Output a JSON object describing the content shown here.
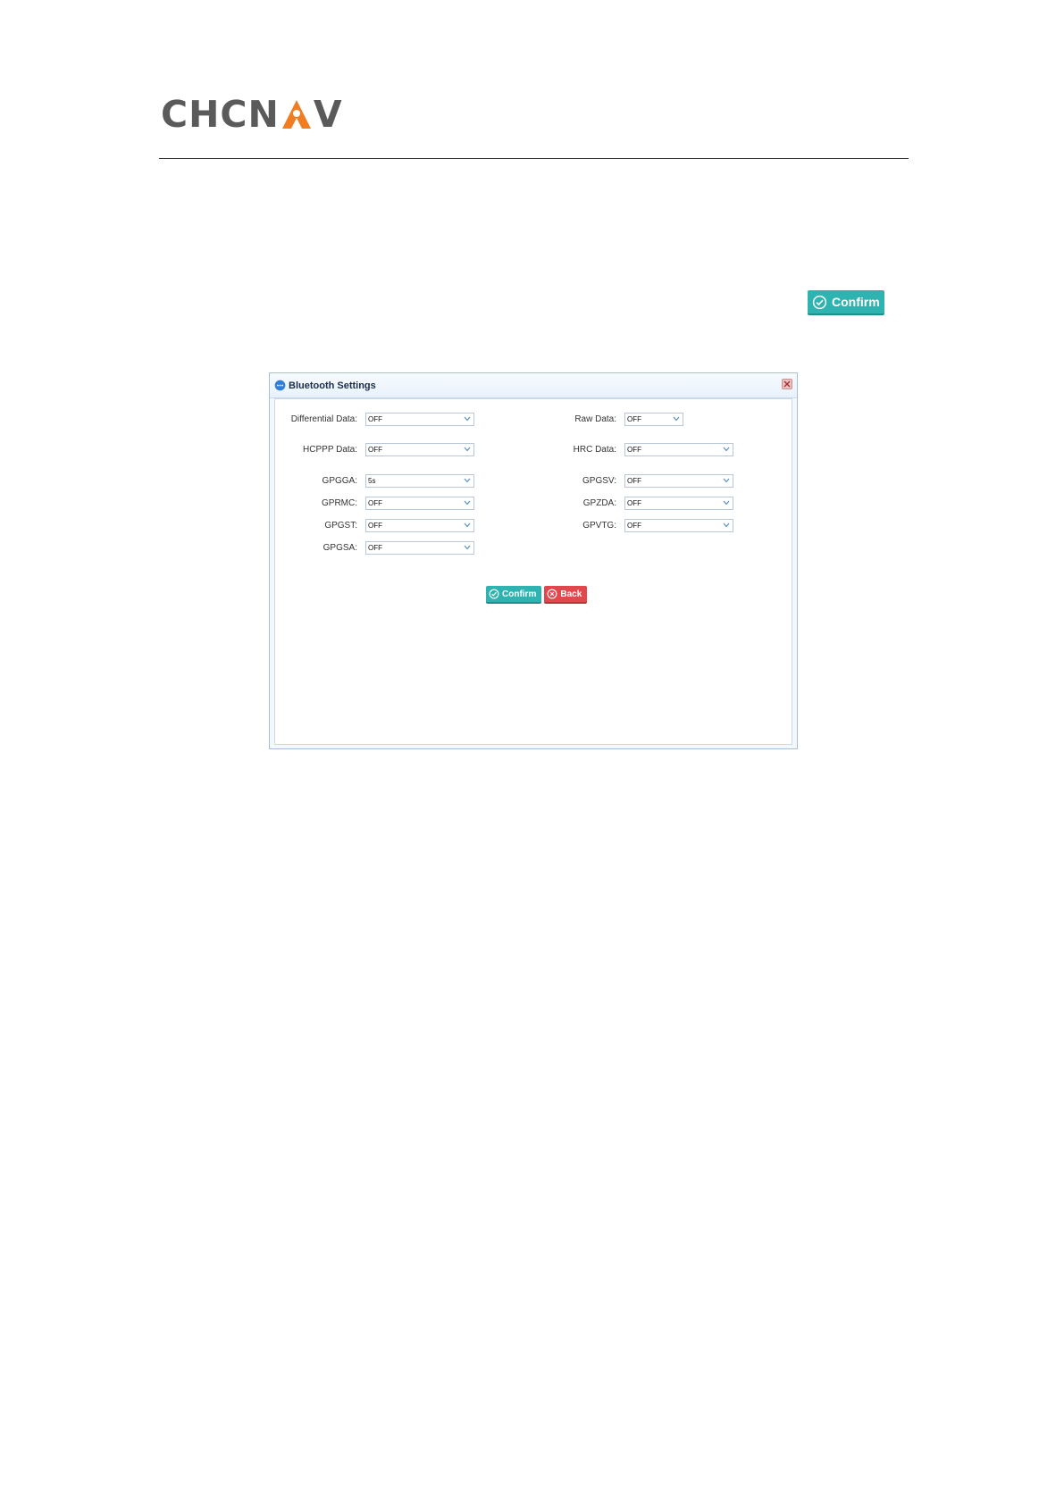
{
  "header": {
    "logo_left": "CHCN",
    "logo_right": "V",
    "brand_orange": "#f07d22",
    "brand_gray": "#5a5a5a"
  },
  "top_button": {
    "label": "Confirm",
    "color": "#2fb3b0"
  },
  "dialog": {
    "title": "Bluetooth Settings",
    "left_fields": [
      {
        "label": "Differential Data:",
        "value": "OFF"
      },
      {
        "label": "HCPPP Data:",
        "value": "OFF"
      },
      {
        "label": "GPGGA:",
        "value": "5s"
      },
      {
        "label": "GPRMC:",
        "value": "OFF"
      },
      {
        "label": "GPGST:",
        "value": "OFF"
      },
      {
        "label": "GPGSA:",
        "value": "OFF"
      }
    ],
    "right_fields": [
      {
        "label": "Raw Data:",
        "value": "OFF"
      },
      {
        "label": "HRC Data:",
        "value": "OFF"
      },
      {
        "label": "GPGSV:",
        "value": "OFF"
      },
      {
        "label": "GPZDA:",
        "value": "OFF"
      },
      {
        "label": "GPVTG:",
        "value": "OFF"
      }
    ],
    "confirm_label": "Confirm",
    "back_label": "Back",
    "back_color": "#e0484d"
  }
}
